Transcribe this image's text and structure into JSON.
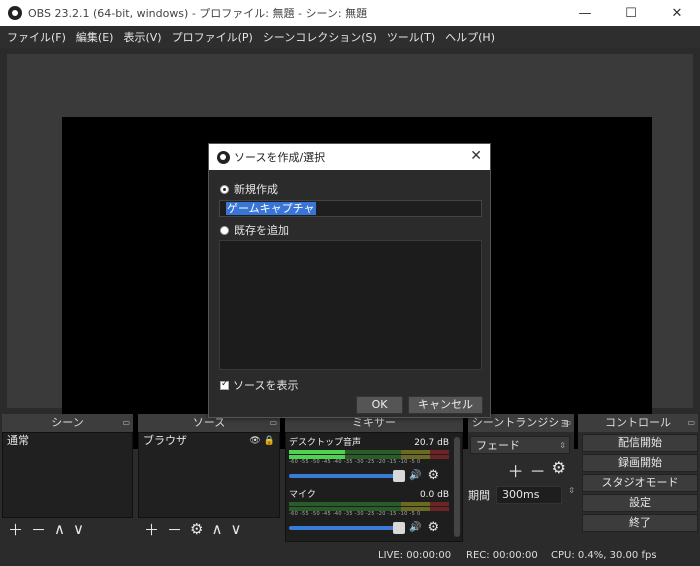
{
  "window": {
    "title": "OBS 23.2.1 (64-bit, windows) - プロファイル: 無題 - シーン: 無題",
    "minimize": "—",
    "maximize": "☐",
    "close": "✕"
  },
  "menu": {
    "items": [
      {
        "label": "ファイル(F)"
      },
      {
        "label": "編集(E)"
      },
      {
        "label": "表示(V)"
      },
      {
        "label": "プロファイル(P)"
      },
      {
        "label": "シーンコレクション(S)"
      },
      {
        "label": "ツール(T)"
      },
      {
        "label": "ヘルプ(H)"
      }
    ]
  },
  "docks": {
    "scenes": {
      "title": "シーン",
      "items": [
        "通常"
      ]
    },
    "sources": {
      "title": "ソース",
      "items": [
        "ブラウザ"
      ]
    },
    "mixer": {
      "title": "ミキサー"
    },
    "transitions": {
      "title": "シーントランジション",
      "selected": "フェード",
      "duration_label": "期間",
      "duration_value": "300ms"
    },
    "controls": {
      "title": "コントロール",
      "buttons": [
        "配信開始",
        "録画開始",
        "スタジオモード",
        "設定",
        "終了"
      ]
    }
  },
  "mixer_tracks": [
    {
      "name": "デスクトップ音声",
      "level": "20.7 dB",
      "meter_level": 0.35,
      "volume": 1.0
    },
    {
      "name": "マイク",
      "level": "0.0 dB",
      "meter_level": 0.0,
      "volume": 1.0
    }
  ],
  "meter_scale": "-60 -55 -50 -45 -40 -35 -30 -25 -20 -15 -10 -5 0",
  "status": {
    "live": "LIVE: 00:00:00",
    "rec": "REC: 00:00:00",
    "cpu": "CPU: 0.4%, 30.00 fps"
  },
  "dialog": {
    "title": "ソースを作成/選択",
    "create_new_label": "新規作成",
    "name_value": "ゲームキャプチャ",
    "add_existing_label": "既存を追加",
    "show_source_label": "ソースを表示",
    "ok": "OK",
    "cancel": "キャンセル",
    "close": "✕"
  },
  "icons": {
    "plus": "＋",
    "minus": "－",
    "up": "∧",
    "down": "∨",
    "gear": "⚙",
    "eye": "👁",
    "lock": "🔒",
    "speaker": "🔊",
    "float": "▭",
    "spin": "⇳"
  },
  "colors": {
    "accent_blue": "#3875d6",
    "meter_green": "#4fd24f",
    "panel_bg": "#2b2b2b"
  }
}
